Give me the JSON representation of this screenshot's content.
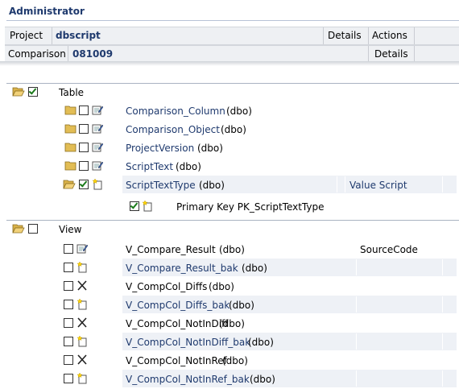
{
  "header": {
    "title": "Administrator"
  },
  "project": {
    "label": "Project",
    "value": "dbscript",
    "details": "Details",
    "actions": "Actions"
  },
  "comparison": {
    "label": "Comparison",
    "value": "081009",
    "details": "Details"
  },
  "table_section": {
    "label": "Table",
    "rows": [
      {
        "name": "Comparison_Column",
        "owner": "(dbo)"
      },
      {
        "name": "Comparison_Object",
        "owner": "(dbo)"
      },
      {
        "name": "ProjectVersion",
        "owner": "(dbo)"
      },
      {
        "name": "ScriptText",
        "owner": "(dbo)"
      },
      {
        "name": "ScriptTextType",
        "owner": "(dbo)",
        "extra": "Value Script"
      }
    ],
    "child": {
      "text": "Primary Key PK_ScriptTextType"
    }
  },
  "view_section": {
    "label": "View",
    "rows": [
      {
        "name": "V_Compare_Result",
        "owner": "(dbo)",
        "extra": "SourceCode"
      },
      {
        "name": "V_Compare_Result_bak",
        "owner": "(dbo)"
      },
      {
        "name": "V_CompCol_Diffs",
        "owner": "(dbo)"
      },
      {
        "name": "V_CompCol_Diffs_bak",
        "owner": "(dbo)"
      },
      {
        "name": "V_CompCol_NotInDiff",
        "owner": "(dbo)"
      },
      {
        "name": "V_CompCol_NotInDiff_bak",
        "owner": "(dbo)"
      },
      {
        "name": "V_CompCol_NotInRef",
        "owner": "(dbo)"
      },
      {
        "name": "V_CompCol_NotInRef_bak",
        "owner": "(dbo)"
      }
    ]
  },
  "colors": {
    "accent": "#1f3a6e",
    "altrow": "#eef1f6",
    "infobar": "#eef0f3"
  }
}
